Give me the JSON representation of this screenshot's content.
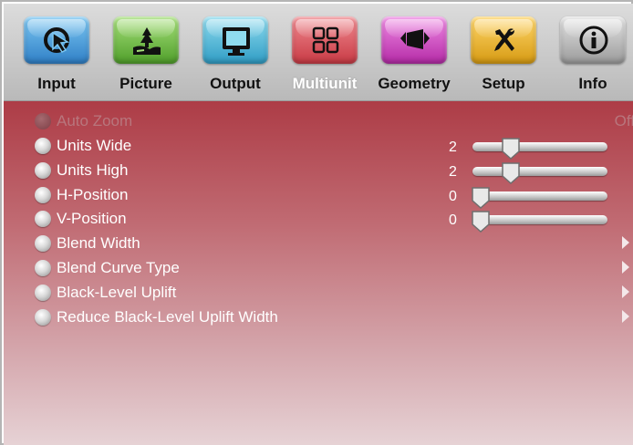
{
  "tabs": [
    {
      "label": "Input",
      "icon": "input-arrow-icon",
      "color": "#3a8fd4"
    },
    {
      "label": "Picture",
      "icon": "landscape-picture-icon",
      "color": "#62b43a"
    },
    {
      "label": "Output",
      "icon": "monitor-icon",
      "color": "#3aa6cf"
    },
    {
      "label": "Multiunit",
      "icon": "multiunit-grid-icon",
      "color": "#d24a52"
    },
    {
      "label": "Geometry",
      "icon": "geometry-skew-icon",
      "color": "#c02fb0"
    },
    {
      "label": "Setup",
      "icon": "tools-icon",
      "color": "#e0aa1e"
    },
    {
      "label": "Info",
      "icon": "info-icon",
      "color": "#9a9a9a"
    }
  ],
  "active_tab": "Multiunit",
  "menu": {
    "items": [
      {
        "label": "Auto Zoom",
        "value": "Off",
        "disabled": true
      },
      {
        "label": "Units Wide",
        "value": "2",
        "slider_fraction": 0.26
      },
      {
        "label": "Units High",
        "value": "2",
        "slider_fraction": 0.26
      },
      {
        "label": "H-Position",
        "value": "0",
        "slider_fraction": 0.0
      },
      {
        "label": "V-Position",
        "value": "0",
        "slider_fraction": 0.0
      },
      {
        "label": "Blend Width",
        "submenu": true
      },
      {
        "label": "Blend Curve Type",
        "submenu": true
      },
      {
        "label": "Black-Level Uplift",
        "submenu": true
      },
      {
        "label": "Reduce Black-Level Uplift Width",
        "submenu": true
      }
    ]
  }
}
